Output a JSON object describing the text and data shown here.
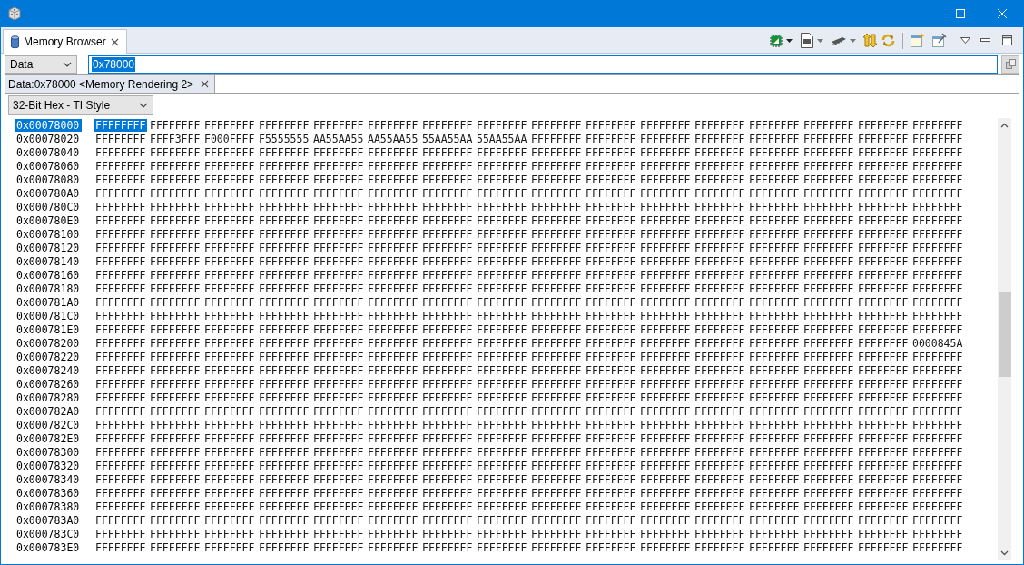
{
  "view_tab": {
    "label": "Memory Browser",
    "selected": true
  },
  "memory_space": {
    "value": "Data"
  },
  "address_field": {
    "value": "0x78000",
    "text_selected": true
  },
  "rendering_tab": {
    "label": "Data:0x78000 <Memory Rendering 2>",
    "selected": true
  },
  "format": {
    "value": "32-Bit Hex - TI Style"
  },
  "rows": [
    {
      "address": "0x00078000",
      "selected": true,
      "words": [
        "FFFFFFFF",
        "FFFFFFFF",
        "FFFFFFFF",
        "FFFFFFFF",
        "FFFFFFFF",
        "FFFFFFFF",
        "FFFFFFFF",
        "FFFFFFFF",
        "FFFFFFFF",
        "FFFFFFFF",
        "FFFFFFFF",
        "FFFFFFFF",
        "FFFFFFFF",
        "FFFFFFFF",
        "FFFFFFFF",
        "FFFFFFFF"
      ]
    },
    {
      "address": "0x00078020",
      "selected": false,
      "words": [
        "FFFFFFFF",
        "FFFF3FFF",
        "F000FFFF",
        "F5555555",
        "AA55AA55",
        "AA55AA55",
        "55AA55AA",
        "55AA55AA",
        "FFFFFFFF",
        "FFFFFFFF",
        "FFFFFFFF",
        "FFFFFFFF",
        "FFFFFFFF",
        "FFFFFFFF",
        "FFFFFFFF",
        "FFFFFFFF"
      ]
    },
    {
      "address": "0x00078040",
      "selected": false,
      "words": [
        "FFFFFFFF",
        "FFFFFFFF",
        "FFFFFFFF",
        "FFFFFFFF",
        "FFFFFFFF",
        "FFFFFFFF",
        "FFFFFFFF",
        "FFFFFFFF",
        "FFFFFFFF",
        "FFFFFFFF",
        "FFFFFFFF",
        "FFFFFFFF",
        "FFFFFFFF",
        "FFFFFFFF",
        "FFFFFFFF",
        "FFFFFFFF"
      ]
    },
    {
      "address": "0x00078060",
      "selected": false,
      "words": [
        "FFFFFFFF",
        "FFFFFFFF",
        "FFFFFFFF",
        "FFFFFFFF",
        "FFFFFFFF",
        "FFFFFFFF",
        "FFFFFFFF",
        "FFFFFFFF",
        "FFFFFFFF",
        "FFFFFFFF",
        "FFFFFFFF",
        "FFFFFFFF",
        "FFFFFFFF",
        "FFFFFFFF",
        "FFFFFFFF",
        "FFFFFFFF"
      ]
    },
    {
      "address": "0x00078080",
      "selected": false,
      "words": [
        "FFFFFFFF",
        "FFFFFFFF",
        "FFFFFFFF",
        "FFFFFFFF",
        "FFFFFFFF",
        "FFFFFFFF",
        "FFFFFFFF",
        "FFFFFFFF",
        "FFFFFFFF",
        "FFFFFFFF",
        "FFFFFFFF",
        "FFFFFFFF",
        "FFFFFFFF",
        "FFFFFFFF",
        "FFFFFFFF",
        "FFFFFFFF"
      ]
    },
    {
      "address": "0x000780A0",
      "selected": false,
      "words": [
        "FFFFFFFF",
        "FFFFFFFF",
        "FFFFFFFF",
        "FFFFFFFF",
        "FFFFFFFF",
        "FFFFFFFF",
        "FFFFFFFF",
        "FFFFFFFF",
        "FFFFFFFF",
        "FFFFFFFF",
        "FFFFFFFF",
        "FFFFFFFF",
        "FFFFFFFF",
        "FFFFFFFF",
        "FFFFFFFF",
        "FFFFFFFF"
      ]
    },
    {
      "address": "0x000780C0",
      "selected": false,
      "words": [
        "FFFFFFFF",
        "FFFFFFFF",
        "FFFFFFFF",
        "FFFFFFFF",
        "FFFFFFFF",
        "FFFFFFFF",
        "FFFFFFFF",
        "FFFFFFFF",
        "FFFFFFFF",
        "FFFFFFFF",
        "FFFFFFFF",
        "FFFFFFFF",
        "FFFFFFFF",
        "FFFFFFFF",
        "FFFFFFFF",
        "FFFFFFFF"
      ]
    },
    {
      "address": "0x000780E0",
      "selected": false,
      "words": [
        "FFFFFFFF",
        "FFFFFFFF",
        "FFFFFFFF",
        "FFFFFFFF",
        "FFFFFFFF",
        "FFFFFFFF",
        "FFFFFFFF",
        "FFFFFFFF",
        "FFFFFFFF",
        "FFFFFFFF",
        "FFFFFFFF",
        "FFFFFFFF",
        "FFFFFFFF",
        "FFFFFFFF",
        "FFFFFFFF",
        "FFFFFFFF"
      ]
    },
    {
      "address": "0x00078100",
      "selected": false,
      "words": [
        "FFFFFFFF",
        "FFFFFFFF",
        "FFFFFFFF",
        "FFFFFFFF",
        "FFFFFFFF",
        "FFFFFFFF",
        "FFFFFFFF",
        "FFFFFFFF",
        "FFFFFFFF",
        "FFFFFFFF",
        "FFFFFFFF",
        "FFFFFFFF",
        "FFFFFFFF",
        "FFFFFFFF",
        "FFFFFFFF",
        "FFFFFFFF"
      ]
    },
    {
      "address": "0x00078120",
      "selected": false,
      "words": [
        "FFFFFFFF",
        "FFFFFFFF",
        "FFFFFFFF",
        "FFFFFFFF",
        "FFFFFFFF",
        "FFFFFFFF",
        "FFFFFFFF",
        "FFFFFFFF",
        "FFFFFFFF",
        "FFFFFFFF",
        "FFFFFFFF",
        "FFFFFFFF",
        "FFFFFFFF",
        "FFFFFFFF",
        "FFFFFFFF",
        "FFFFFFFF"
      ]
    },
    {
      "address": "0x00078140",
      "selected": false,
      "words": [
        "FFFFFFFF",
        "FFFFFFFF",
        "FFFFFFFF",
        "FFFFFFFF",
        "FFFFFFFF",
        "FFFFFFFF",
        "FFFFFFFF",
        "FFFFFFFF",
        "FFFFFFFF",
        "FFFFFFFF",
        "FFFFFFFF",
        "FFFFFFFF",
        "FFFFFFFF",
        "FFFFFFFF",
        "FFFFFFFF",
        "FFFFFFFF"
      ]
    },
    {
      "address": "0x00078160",
      "selected": false,
      "words": [
        "FFFFFFFF",
        "FFFFFFFF",
        "FFFFFFFF",
        "FFFFFFFF",
        "FFFFFFFF",
        "FFFFFFFF",
        "FFFFFFFF",
        "FFFFFFFF",
        "FFFFFFFF",
        "FFFFFFFF",
        "FFFFFFFF",
        "FFFFFFFF",
        "FFFFFFFF",
        "FFFFFFFF",
        "FFFFFFFF",
        "FFFFFFFF"
      ]
    },
    {
      "address": "0x00078180",
      "selected": false,
      "words": [
        "FFFFFFFF",
        "FFFFFFFF",
        "FFFFFFFF",
        "FFFFFFFF",
        "FFFFFFFF",
        "FFFFFFFF",
        "FFFFFFFF",
        "FFFFFFFF",
        "FFFFFFFF",
        "FFFFFFFF",
        "FFFFFFFF",
        "FFFFFFFF",
        "FFFFFFFF",
        "FFFFFFFF",
        "FFFFFFFF",
        "FFFFFFFF"
      ]
    },
    {
      "address": "0x000781A0",
      "selected": false,
      "words": [
        "FFFFFFFF",
        "FFFFFFFF",
        "FFFFFFFF",
        "FFFFFFFF",
        "FFFFFFFF",
        "FFFFFFFF",
        "FFFFFFFF",
        "FFFFFFFF",
        "FFFFFFFF",
        "FFFFFFFF",
        "FFFFFFFF",
        "FFFFFFFF",
        "FFFFFFFF",
        "FFFFFFFF",
        "FFFFFFFF",
        "FFFFFFFF"
      ]
    },
    {
      "address": "0x000781C0",
      "selected": false,
      "words": [
        "FFFFFFFF",
        "FFFFFFFF",
        "FFFFFFFF",
        "FFFFFFFF",
        "FFFFFFFF",
        "FFFFFFFF",
        "FFFFFFFF",
        "FFFFFFFF",
        "FFFFFFFF",
        "FFFFFFFF",
        "FFFFFFFF",
        "FFFFFFFF",
        "FFFFFFFF",
        "FFFFFFFF",
        "FFFFFFFF",
        "FFFFFFFF"
      ]
    },
    {
      "address": "0x000781E0",
      "selected": false,
      "words": [
        "FFFFFFFF",
        "FFFFFFFF",
        "FFFFFFFF",
        "FFFFFFFF",
        "FFFFFFFF",
        "FFFFFFFF",
        "FFFFFFFF",
        "FFFFFFFF",
        "FFFFFFFF",
        "FFFFFFFF",
        "FFFFFFFF",
        "FFFFFFFF",
        "FFFFFFFF",
        "FFFFFFFF",
        "FFFFFFFF",
        "FFFFFFFF"
      ]
    },
    {
      "address": "0x00078200",
      "selected": false,
      "words": [
        "FFFFFFFF",
        "FFFFFFFF",
        "FFFFFFFF",
        "FFFFFFFF",
        "FFFFFFFF",
        "FFFFFFFF",
        "FFFFFFFF",
        "FFFFFFFF",
        "FFFFFFFF",
        "FFFFFFFF",
        "FFFFFFFF",
        "FFFFFFFF",
        "FFFFFFFF",
        "FFFFFFFF",
        "FFFFFFFF",
        "0000845A"
      ]
    },
    {
      "address": "0x00078220",
      "selected": false,
      "words": [
        "FFFFFFFF",
        "FFFFFFFF",
        "FFFFFFFF",
        "FFFFFFFF",
        "FFFFFFFF",
        "FFFFFFFF",
        "FFFFFFFF",
        "FFFFFFFF",
        "FFFFFFFF",
        "FFFFFFFF",
        "FFFFFFFF",
        "FFFFFFFF",
        "FFFFFFFF",
        "FFFFFFFF",
        "FFFFFFFF",
        "FFFFFFFF"
      ]
    },
    {
      "address": "0x00078240",
      "selected": false,
      "words": [
        "FFFFFFFF",
        "FFFFFFFF",
        "FFFFFFFF",
        "FFFFFFFF",
        "FFFFFFFF",
        "FFFFFFFF",
        "FFFFFFFF",
        "FFFFFFFF",
        "FFFFFFFF",
        "FFFFFFFF",
        "FFFFFFFF",
        "FFFFFFFF",
        "FFFFFFFF",
        "FFFFFFFF",
        "FFFFFFFF",
        "FFFFFFFF"
      ]
    },
    {
      "address": "0x00078260",
      "selected": false,
      "words": [
        "FFFFFFFF",
        "FFFFFFFF",
        "FFFFFFFF",
        "FFFFFFFF",
        "FFFFFFFF",
        "FFFFFFFF",
        "FFFFFFFF",
        "FFFFFFFF",
        "FFFFFFFF",
        "FFFFFFFF",
        "FFFFFFFF",
        "FFFFFFFF",
        "FFFFFFFF",
        "FFFFFFFF",
        "FFFFFFFF",
        "FFFFFFFF"
      ]
    },
    {
      "address": "0x00078280",
      "selected": false,
      "words": [
        "FFFFFFFF",
        "FFFFFFFF",
        "FFFFFFFF",
        "FFFFFFFF",
        "FFFFFFFF",
        "FFFFFFFF",
        "FFFFFFFF",
        "FFFFFFFF",
        "FFFFFFFF",
        "FFFFFFFF",
        "FFFFFFFF",
        "FFFFFFFF",
        "FFFFFFFF",
        "FFFFFFFF",
        "FFFFFFFF",
        "FFFFFFFF"
      ]
    },
    {
      "address": "0x000782A0",
      "selected": false,
      "words": [
        "FFFFFFFF",
        "FFFFFFFF",
        "FFFFFFFF",
        "FFFFFFFF",
        "FFFFFFFF",
        "FFFFFFFF",
        "FFFFFFFF",
        "FFFFFFFF",
        "FFFFFFFF",
        "FFFFFFFF",
        "FFFFFFFF",
        "FFFFFFFF",
        "FFFFFFFF",
        "FFFFFFFF",
        "FFFFFFFF",
        "FFFFFFFF"
      ]
    },
    {
      "address": "0x000782C0",
      "selected": false,
      "words": [
        "FFFFFFFF",
        "FFFFFFFF",
        "FFFFFFFF",
        "FFFFFFFF",
        "FFFFFFFF",
        "FFFFFFFF",
        "FFFFFFFF",
        "FFFFFFFF",
        "FFFFFFFF",
        "FFFFFFFF",
        "FFFFFFFF",
        "FFFFFFFF",
        "FFFFFFFF",
        "FFFFFFFF",
        "FFFFFFFF",
        "FFFFFFFF"
      ]
    },
    {
      "address": "0x000782E0",
      "selected": false,
      "words": [
        "FFFFFFFF",
        "FFFFFFFF",
        "FFFFFFFF",
        "FFFFFFFF",
        "FFFFFFFF",
        "FFFFFFFF",
        "FFFFFFFF",
        "FFFFFFFF",
        "FFFFFFFF",
        "FFFFFFFF",
        "FFFFFFFF",
        "FFFFFFFF",
        "FFFFFFFF",
        "FFFFFFFF",
        "FFFFFFFF",
        "FFFFFFFF"
      ]
    },
    {
      "address": "0x00078300",
      "selected": false,
      "words": [
        "FFFFFFFF",
        "FFFFFFFF",
        "FFFFFFFF",
        "FFFFFFFF",
        "FFFFFFFF",
        "FFFFFFFF",
        "FFFFFFFF",
        "FFFFFFFF",
        "FFFFFFFF",
        "FFFFFFFF",
        "FFFFFFFF",
        "FFFFFFFF",
        "FFFFFFFF",
        "FFFFFFFF",
        "FFFFFFFF",
        "FFFFFFFF"
      ]
    },
    {
      "address": "0x00078320",
      "selected": false,
      "words": [
        "FFFFFFFF",
        "FFFFFFFF",
        "FFFFFFFF",
        "FFFFFFFF",
        "FFFFFFFF",
        "FFFFFFFF",
        "FFFFFFFF",
        "FFFFFFFF",
        "FFFFFFFF",
        "FFFFFFFF",
        "FFFFFFFF",
        "FFFFFFFF",
        "FFFFFFFF",
        "FFFFFFFF",
        "FFFFFFFF",
        "FFFFFFFF"
      ]
    },
    {
      "address": "0x00078340",
      "selected": false,
      "words": [
        "FFFFFFFF",
        "FFFFFFFF",
        "FFFFFFFF",
        "FFFFFFFF",
        "FFFFFFFF",
        "FFFFFFFF",
        "FFFFFFFF",
        "FFFFFFFF",
        "FFFFFFFF",
        "FFFFFFFF",
        "FFFFFFFF",
        "FFFFFFFF",
        "FFFFFFFF",
        "FFFFFFFF",
        "FFFFFFFF",
        "FFFFFFFF"
      ]
    },
    {
      "address": "0x00078360",
      "selected": false,
      "words": [
        "FFFFFFFF",
        "FFFFFFFF",
        "FFFFFFFF",
        "FFFFFFFF",
        "FFFFFFFF",
        "FFFFFFFF",
        "FFFFFFFF",
        "FFFFFFFF",
        "FFFFFFFF",
        "FFFFFFFF",
        "FFFFFFFF",
        "FFFFFFFF",
        "FFFFFFFF",
        "FFFFFFFF",
        "FFFFFFFF",
        "FFFFFFFF"
      ]
    },
    {
      "address": "0x00078380",
      "selected": false,
      "words": [
        "FFFFFFFF",
        "FFFFFFFF",
        "FFFFFFFF",
        "FFFFFFFF",
        "FFFFFFFF",
        "FFFFFFFF",
        "FFFFFFFF",
        "FFFFFFFF",
        "FFFFFFFF",
        "FFFFFFFF",
        "FFFFFFFF",
        "FFFFFFFF",
        "FFFFFFFF",
        "FFFFFFFF",
        "FFFFFFFF",
        "FFFFFFFF"
      ]
    },
    {
      "address": "0x000783A0",
      "selected": false,
      "words": [
        "FFFFFFFF",
        "FFFFFFFF",
        "FFFFFFFF",
        "FFFFFFFF",
        "FFFFFFFF",
        "FFFFFFFF",
        "FFFFFFFF",
        "FFFFFFFF",
        "FFFFFFFF",
        "FFFFFFFF",
        "FFFFFFFF",
        "FFFFFFFF",
        "FFFFFFFF",
        "FFFFFFFF",
        "FFFFFFFF",
        "FFFFFFFF"
      ]
    },
    {
      "address": "0x000783C0",
      "selected": false,
      "words": [
        "FFFFFFFF",
        "FFFFFFFF",
        "FFFFFFFF",
        "FFFFFFFF",
        "FFFFFFFF",
        "FFFFFFFF",
        "FFFFFFFF",
        "FFFFFFFF",
        "FFFFFFFF",
        "FFFFFFFF",
        "FFFFFFFF",
        "FFFFFFFF",
        "FFFFFFFF",
        "FFFFFFFF",
        "FFFFFFFF",
        "FFFFFFFF"
      ]
    },
    {
      "address": "0x000783E0",
      "selected": false,
      "words": [
        "FFFFFFFF",
        "FFFFFFFF",
        "FFFFFFFF",
        "FFFFFFFF",
        "FFFFFFFF",
        "FFFFFFFF",
        "FFFFFFFF",
        "FFFFFFFF",
        "FFFFFFFF",
        "FFFFFFFF",
        "FFFFFFFF",
        "FFFFFFFF",
        "FFFFFFFF",
        "FFFFFFFF",
        "FFFFFFFF",
        "FFFFFFFF"
      ]
    }
  ]
}
